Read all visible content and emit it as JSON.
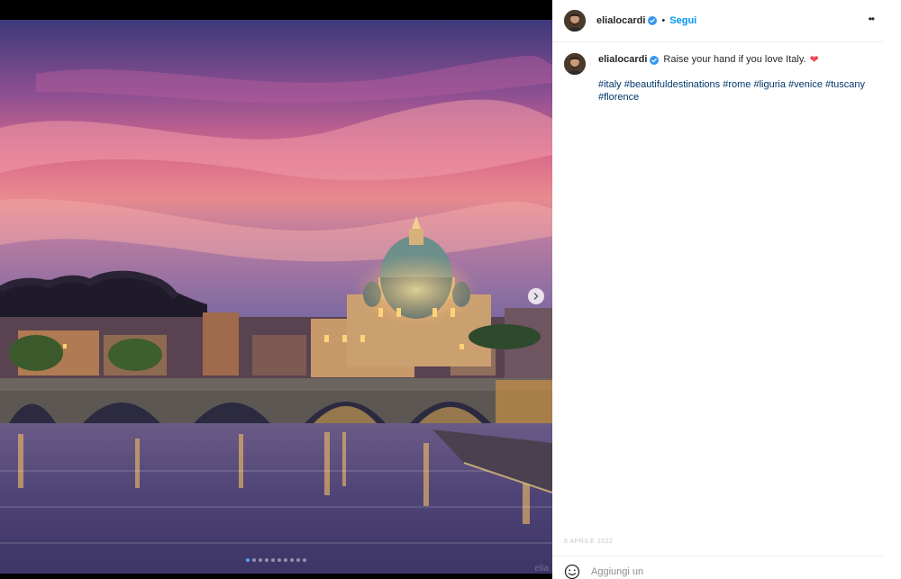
{
  "post": {
    "username": "elialocardi",
    "follow_label": "Segui",
    "separator": "•",
    "more_label": "••",
    "caption": "Raise your hand if you love Italy.",
    "caption_emoji": "❤",
    "hashtags": [
      "#italy",
      "#beautifuldestinations",
      "#rome",
      "#liguria",
      "#venice",
      "#tuscany",
      "#florence"
    ],
    "date_faded": "8 APRILE 2022",
    "comment_placeholder": "Aggiungi un commento..."
  },
  "media": {
    "slide_count": 10,
    "active_slide": 1,
    "watermark": "elia"
  },
  "colors": {
    "accent": "#0095f6",
    "hashtag": "#00376b",
    "heart": "#ed4956",
    "verified": "#3897f0"
  }
}
